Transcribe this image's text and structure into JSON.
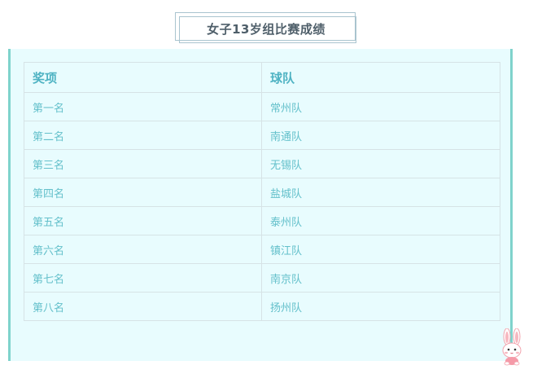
{
  "title": "女子13岁组比赛成绩",
  "table": {
    "headers": [
      "奖项",
      "球队"
    ],
    "rows": [
      [
        "第一名",
        "常州队"
      ],
      [
        "第二名",
        "南通队"
      ],
      [
        "第三名",
        "无锡队"
      ],
      [
        "第四名",
        "盐城队"
      ],
      [
        "第五名",
        "泰州队"
      ],
      [
        "第六名",
        "镇江队"
      ],
      [
        "第七名",
        "南京队"
      ],
      [
        "第八名",
        "扬州队"
      ]
    ]
  },
  "colors": {
    "accent_border": "#7fd3cc",
    "panel_bg": "#e8fcfe",
    "header_text": "#4fb3c3",
    "cell_text": "#64c0cb",
    "title_text": "#4f5f6a"
  },
  "icons": {
    "corner_decoration": "bunny-icon"
  }
}
